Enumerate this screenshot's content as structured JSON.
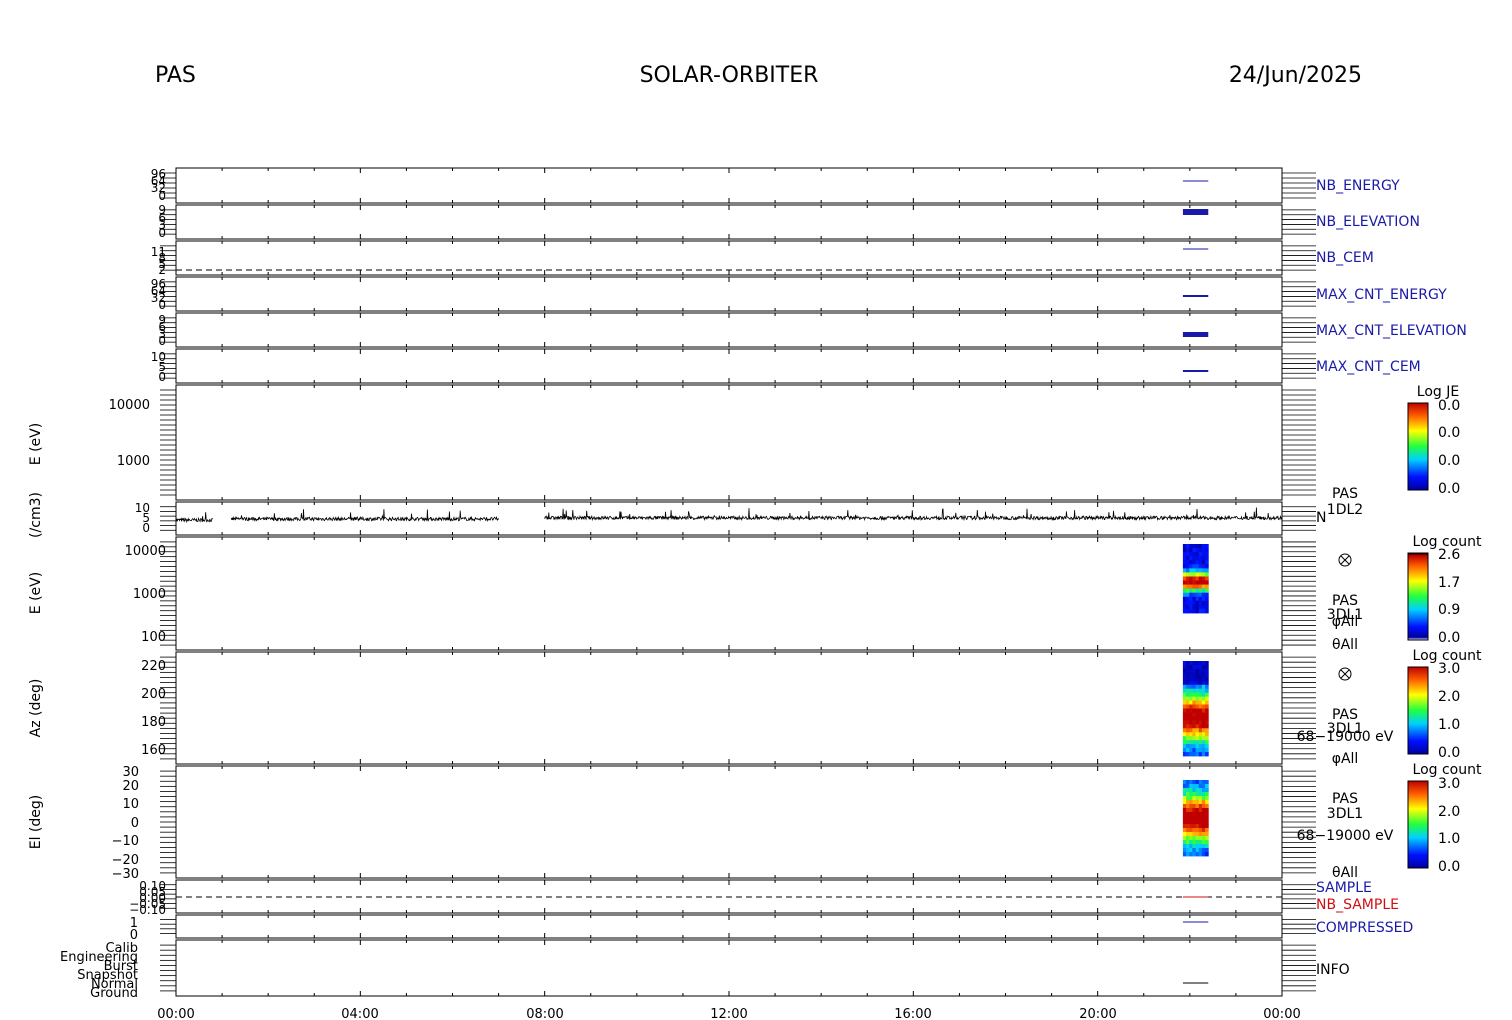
{
  "header": {
    "instrument": "PAS",
    "mission": "SOLAR-ORBITER",
    "date": "24/Jun/2025"
  },
  "colors": {
    "trace_blue": "#1a1aa8",
    "nb_sample_red": "#d01010",
    "axis": "#000000"
  },
  "chart_data": {
    "type": "heatmap",
    "x_axis": {
      "ticks": [
        "00:00",
        "04:00",
        "08:00",
        "12:00",
        "16:00",
        "20:00",
        "00:00"
      ],
      "range_hours": [
        0,
        24
      ]
    },
    "active_interval_hours": [
      21.85,
      22.4
    ],
    "panels": [
      {
        "id": "nb_energy",
        "label": "NB_ENERGY",
        "tick_labels": [
          "96",
          "64",
          "32",
          "0"
        ]
      },
      {
        "id": "nb_elevation",
        "label": "NB_ELEVATION",
        "tick_labels": [
          "9",
          "6",
          "3",
          "0"
        ]
      },
      {
        "id": "nb_cem",
        "label": "NB_CEM",
        "tick_labels": [
          "11",
          "8",
          "5",
          "2"
        ]
      },
      {
        "id": "max_cnt_energy",
        "label": "MAX_CNT_ENERGY",
        "tick_labels": [
          "96",
          "64",
          "32",
          "0"
        ]
      },
      {
        "id": "max_cnt_elevation",
        "label": "MAX_CNT_ELEVATION",
        "tick_labels": [
          "9",
          "6",
          "3",
          "0"
        ]
      },
      {
        "id": "max_cnt_cem",
        "label": "MAX_CNT_CEM",
        "tick_labels": [
          "10",
          "5",
          "0"
        ]
      },
      {
        "id": "l2_energy",
        "ylabel": "E (eV)",
        "tick_labels": [
          "10000",
          "1000"
        ],
        "colorbar": {
          "title": "Log JE",
          "ticks": [
            "0.0",
            "0.0",
            "0.0",
            "0.0"
          ]
        },
        "side_labels": [
          "PAS",
          "1DL2"
        ]
      },
      {
        "id": "density",
        "ylabel": "(/cm3)",
        "tick_labels": [
          "10",
          "5",
          "0"
        ],
        "side_labels": [
          "N"
        ],
        "series": [
          {
            "hours": [
              0.0,
              0.8
            ],
            "mean": 4.5
          },
          {
            "hours": [
              1.2,
              7.0
            ],
            "mean": 5.0
          },
          {
            "hours": [
              8.0,
              24.0
            ],
            "mean": 5.5
          }
        ]
      },
      {
        "id": "l1_energy",
        "ylabel": "E (eV)",
        "tick_labels": [
          "10000",
          "1000",
          "100"
        ],
        "colorbar": {
          "title": "Log count",
          "ticks": [
            "2.6",
            "1.7",
            "0.9",
            "0.0"
          ]
        },
        "side_labels": [
          "PAS",
          "3DL1",
          "φAll",
          "θAll"
        ]
      },
      {
        "id": "azimuth",
        "ylabel": "Az (deg)",
        "tick_labels": [
          "220",
          "200",
          "180",
          "160"
        ],
        "colorbar": {
          "title": "Log count",
          "ticks": [
            "3.0",
            "2.0",
            "1.0",
            "0.0"
          ]
        },
        "side_labels": [
          "PAS",
          "3DL1",
          "68−19000 eV",
          "φAll"
        ]
      },
      {
        "id": "elevation",
        "ylabel": "El (deg)",
        "tick_labels": [
          "30",
          "20",
          "10",
          "0",
          "−10",
          "−20",
          "−30"
        ],
        "colorbar": {
          "title": "Log count",
          "ticks": [
            "3.0",
            "2.0",
            "1.0",
            "0.0"
          ]
        },
        "side_labels": [
          "PAS",
          "3DL1",
          "68−19000 eV",
          "θAll"
        ]
      },
      {
        "id": "sample",
        "labels": [
          "SAMPLE",
          "NB_SAMPLE"
        ],
        "tick_labels": [
          "0.10",
          "0.05",
          "0.00",
          "−0.05",
          "−0.10"
        ]
      },
      {
        "id": "compressed",
        "label": "COMPRESSED",
        "tick_labels": [
          "1",
          "0"
        ]
      },
      {
        "id": "info",
        "label": "INFO",
        "tick_labels": [
          "Calib",
          "Engineering",
          "Burst",
          "Snapshot",
          "Normal",
          "Ground"
        ]
      }
    ]
  }
}
